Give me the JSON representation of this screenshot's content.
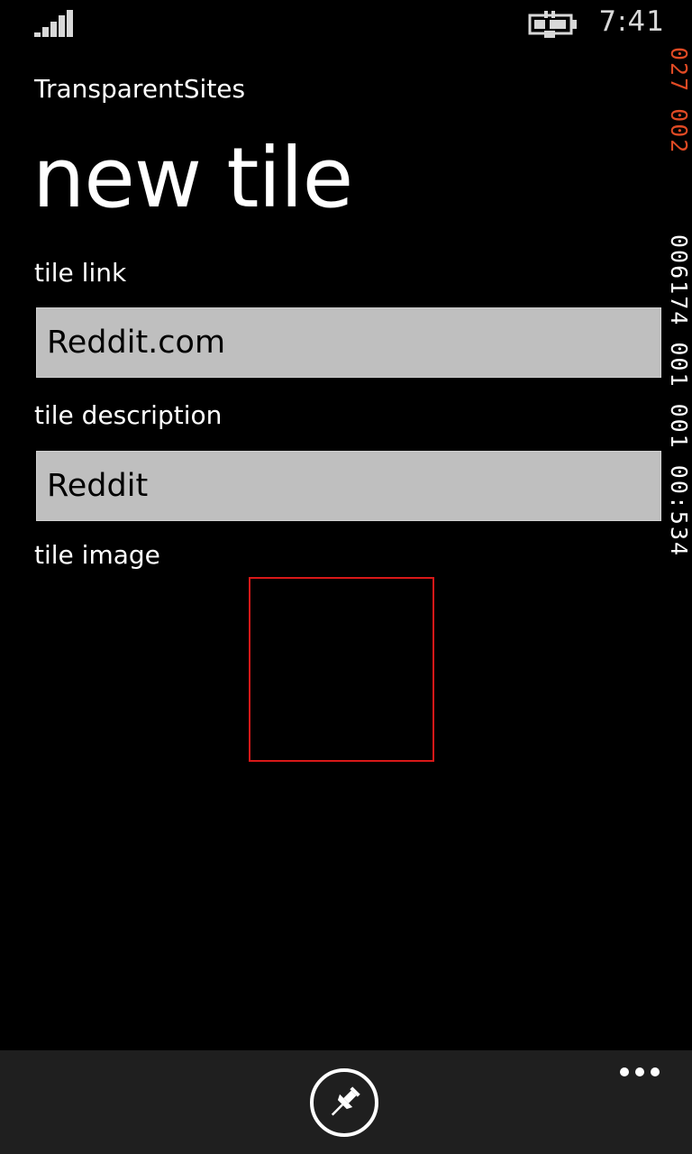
{
  "status_bar": {
    "time": "7:41",
    "signal_icon": "signal-strength-icon",
    "battery_icon": "battery-charging-icon"
  },
  "debug_counters": {
    "line1": "027 002",
    "line2": "006174 001 001 00:534"
  },
  "app": {
    "name": "TransparentSites",
    "page_title": "new tile"
  },
  "form": {
    "link_label": "tile link",
    "link_value": "Reddit.com",
    "description_label": "tile description",
    "description_value": "Reddit",
    "image_label": "tile image"
  },
  "app_bar": {
    "pin_icon": "pin-icon",
    "more_icon": "ellipsis-icon"
  },
  "colors": {
    "background": "#000000",
    "app_bar": "#1f1f1f",
    "textbox": "#bfbfbf",
    "image_border": "#d81818",
    "counter_accent": "#e04a24"
  }
}
